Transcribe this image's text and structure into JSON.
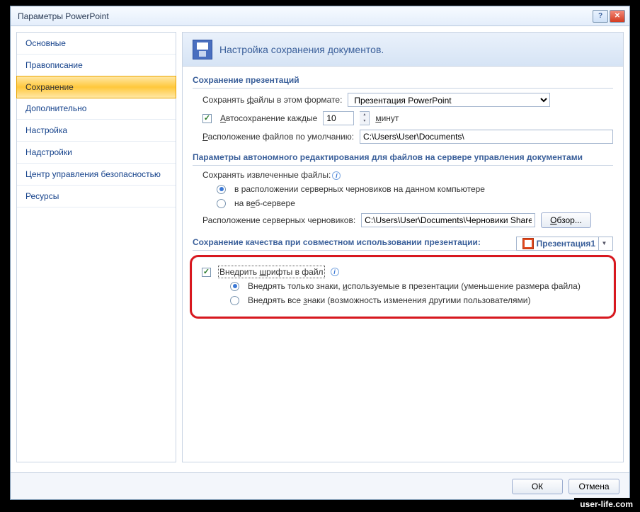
{
  "window": {
    "title": "Параметры PowerPoint"
  },
  "sidebar": {
    "items": [
      {
        "label": "Основные"
      },
      {
        "label": "Правописание"
      },
      {
        "label": "Сохранение"
      },
      {
        "label": "Дополнительно"
      },
      {
        "label": "Настройка"
      },
      {
        "label": "Надстройки"
      },
      {
        "label": "Центр управления безопасностью"
      },
      {
        "label": "Ресурсы"
      }
    ]
  },
  "header": {
    "text": "Настройка сохранения документов."
  },
  "sections": {
    "save_pres": "Сохранение презентаций",
    "offline": "Параметры автономного редактирования для файлов на сервере управления документами",
    "quality": "Сохранение качества при совместном использовании презентации:"
  },
  "save": {
    "format_label_pre": "Сохранять ",
    "format_label_u": "ф",
    "format_label_post": "айлы в этом формате:",
    "format_value": "Презентация PowerPoint",
    "autosave_pre": "",
    "autosave_u": "А",
    "autosave_post": "втосохранение каждые",
    "autosave_value": "10",
    "autosave_unit_u": "м",
    "autosave_unit_post": "инут",
    "location_label_u": "Р",
    "location_label_post": "асположение файлов по умолчанию:",
    "location_value": "C:\\Users\\User\\Documents\\"
  },
  "offline": {
    "extract_label": "Сохранять извлеченные файлы:",
    "opt_local": "в расположении серверных черновиков на данном компьютере",
    "opt_web_pre": "на в",
    "opt_web_u": "е",
    "opt_web_post": "б-сервере",
    "drafts_label": "Расположение серверных черновиков:",
    "drafts_value": "C:\\Users\\User\\Documents\\Черновики SharePo",
    "browse_u": "О",
    "browse_post": "бзор..."
  },
  "quality": {
    "pres_name": "Презентация1"
  },
  "embed": {
    "check_pre": "Внедрить ",
    "check_u": "ш",
    "check_post": "рифты в файл",
    "opt1_pre": "Внедрять только знаки, ",
    "opt1_u": "и",
    "opt1_post": "спользуемые в презентации (уменьшение размера файла)",
    "opt2_pre": "Внедрять все ",
    "opt2_u": "з",
    "opt2_post": "наки (возможность изменения другими пользователями)"
  },
  "buttons": {
    "ok": "ОК",
    "cancel": "Отмена"
  },
  "watermark": "user-life.com"
}
